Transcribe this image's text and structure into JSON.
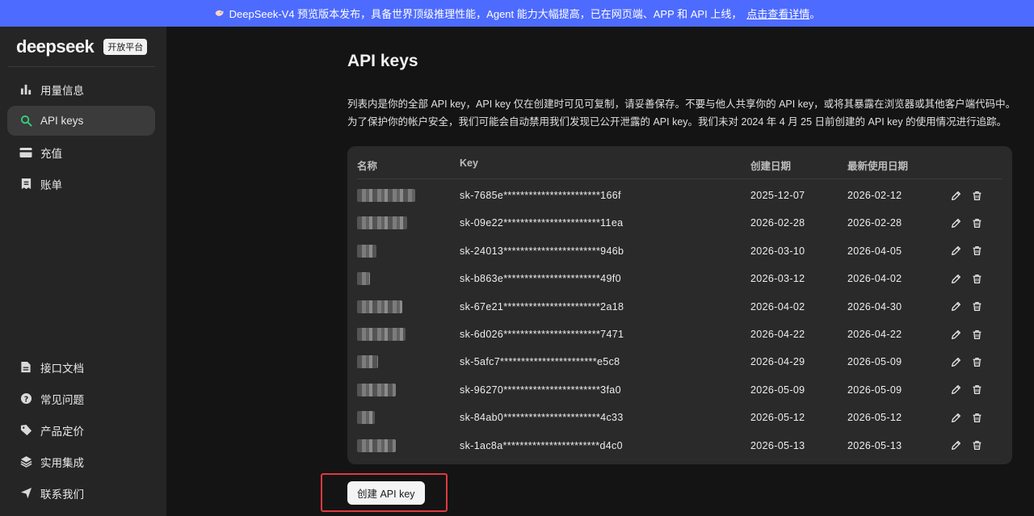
{
  "banner": {
    "icon": "whale-icon",
    "text": "DeepSeek-V4 预览版本发布，具备世界顶级推理性能，Agent 能力大幅提高，已在网页端、APP 和 API 上线，",
    "link": "点击查看详情",
    "suffix": "。",
    "color": "#4d6bfe"
  },
  "sidebar": {
    "logo": "deepseek",
    "badge": "开放平台",
    "top_items": [
      {
        "label": "用量信息",
        "icon": "bar-chart-icon"
      },
      {
        "label": "API keys",
        "icon": "search-key-icon",
        "active": true
      },
      {
        "label": "充值",
        "icon": "card-icon"
      },
      {
        "label": "账单",
        "icon": "bill-icon"
      }
    ],
    "bottom_items": [
      {
        "label": "接口文档",
        "icon": "document-icon"
      },
      {
        "label": "常见问题",
        "icon": "question-icon"
      },
      {
        "label": "产品定价",
        "icon": "tag-icon"
      },
      {
        "label": "实用集成",
        "icon": "layers-icon"
      },
      {
        "label": "联系我们",
        "icon": "send-icon"
      }
    ]
  },
  "main": {
    "title": "API keys",
    "desc_line1": "列表内是你的全部 API key，API key 仅在创建时可见可复制，请妥善保存。不要与他人共享你的 API key，或将其暴露在浏览器或其他客户端代码中。",
    "desc_line2": "为了保护你的帐户安全，我们可能会自动禁用我们发现已公开泄露的 API key。我们未对 2024 年 4 月 25 日前创建的 API key 的使用情况进行追踪。",
    "table": {
      "headers": {
        "name": "名称",
        "key": "Key",
        "created": "创建日期",
        "last_used": "最新使用日期"
      },
      "rows": [
        {
          "key": "sk-7685e***********************166f",
          "created": "2025-12-07",
          "last_used": "2026-02-12"
        },
        {
          "key": "sk-09e22***********************11ea",
          "created": "2026-02-28",
          "last_used": "2026-02-28"
        },
        {
          "key": "sk-24013***********************946b",
          "created": "2026-03-10",
          "last_used": "2026-04-05"
        },
        {
          "key": "sk-b863e***********************49f0",
          "created": "2026-03-12",
          "last_used": "2026-04-02"
        },
        {
          "key": "sk-67e21***********************2a18",
          "created": "2026-04-02",
          "last_used": "2026-04-30"
        },
        {
          "key": "sk-6d026***********************7471",
          "created": "2026-04-22",
          "last_used": "2026-04-22"
        },
        {
          "key": "sk-5afc7***********************e5c8",
          "created": "2026-04-29",
          "last_used": "2026-05-09"
        },
        {
          "key": "sk-96270***********************3fa0",
          "created": "2026-05-09",
          "last_used": "2026-05-09"
        },
        {
          "key": "sk-84ab0***********************4c33",
          "created": "2026-05-12",
          "last_used": "2026-05-12"
        },
        {
          "key": "sk-1ac8a***********************d4c0",
          "created": "2026-05-13",
          "last_used": "2026-05-13"
        }
      ]
    },
    "create_button": "创建 API key",
    "highlight_color": "#e0393e"
  }
}
